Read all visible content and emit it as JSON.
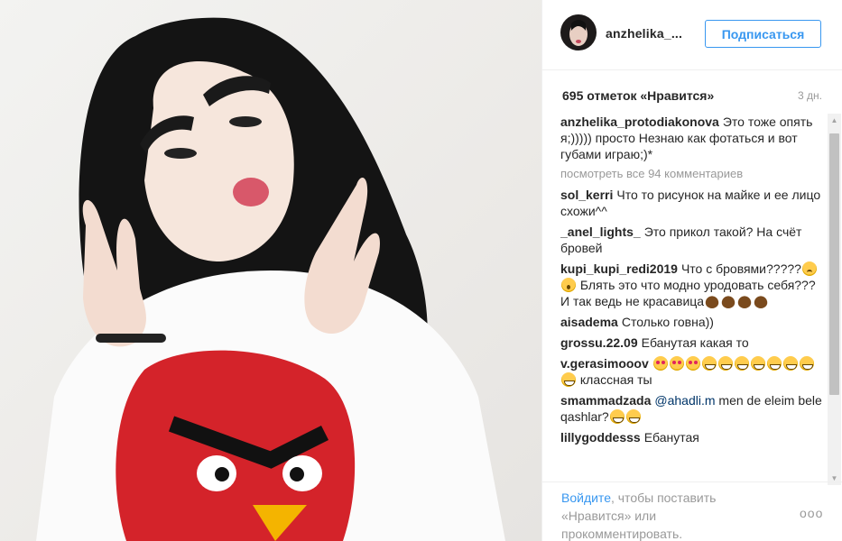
{
  "post": {
    "username": "anzhelika_...",
    "follow_label": "Подписаться",
    "likes": "695 отметок «Нравится»",
    "time_ago": "3 дн.",
    "view_all": "посмотреть все 94 комментариев",
    "caption": {
      "author": "anzhelika_protodiakonova",
      "text": "Это тоже опять я;))))) просто Незнаю как фотаться и вот губами играю;)*"
    },
    "comments": [
      {
        "author": "sol_kerri",
        "text": "Что то рисунок на майке и ее лицо схожи^^"
      },
      {
        "author": "_anel_lights_",
        "text": "Это прикол такой? На счёт бровей"
      },
      {
        "author": "kupi_kupi_redi2019",
        "text_a": "Что с бровями?????",
        "text_b": "Блять это что модно уродовать себя??? И так ведь не красавица"
      },
      {
        "author": "aisadema",
        "text": "Столько говна))"
      },
      {
        "author": "grossu.22.09",
        "text": "Ебанутая какая то"
      },
      {
        "author": "v.gerasimooov",
        "text": "классная ты"
      },
      {
        "author": "smammadzada",
        "mention": "@ahadli.m",
        "text_a": "men de eleim bele qashlar?"
      },
      {
        "author": "lillygoddesss",
        "text": "Ебанутая"
      }
    ],
    "login_link": "Войдите",
    "login_rest": ", чтобы поставить «Нравится» или прокомментировать.",
    "more_label": "ооо"
  },
  "colors": {
    "link": "#3897f0",
    "text": "#262626",
    "muted": "#999999"
  }
}
